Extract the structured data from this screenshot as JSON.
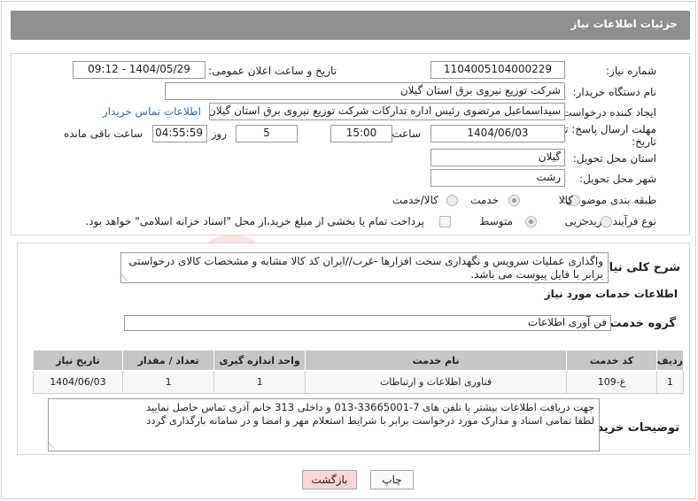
{
  "header": {
    "title": "جزئیات اطلاعات نیاز"
  },
  "form": {
    "need_number_label": "شماره نیاز:",
    "need_number": "1104005104000229",
    "announce_label": "تاریخ و ساعت اعلان عمومی:",
    "announce_value": "1404/05/29 - 09:12",
    "buyer_org_label": "نام دستگاه خریدار:",
    "buyer_org": "شرکت توزیع نیروی برق استان گیلان",
    "creator_label": "ایجاد کننده درخواست:",
    "creator": "سیداسماعیل مرتضوی رئیس اداره تدارکات شرکت توزیع نیروی برق استان گیلان",
    "contact_link": "اطلاعات تماس خریدار",
    "deadline_label_1": "مهلت ارسال پاسخ: تا",
    "deadline_label_2": "تاریخ:",
    "deadline_date": "1404/06/03",
    "time_label": "ساعت",
    "deadline_time": "15:00",
    "days_value": "5",
    "days_label": "روز و",
    "remaining_time": "04:55:59",
    "remaining_label": "ساعت باقی مانده",
    "province_label": "استان محل تحویل:",
    "province": "گیلان",
    "city_label": "شهر محل تحویل:",
    "city": "رشت",
    "category_label": "طبقه بندی موضوعی:",
    "category_options": [
      "کالا",
      "خدمت",
      "کالا/خدمت"
    ],
    "category_selected": "خدمت",
    "process_label": "نوع فرآیند خرید :",
    "process_options": [
      "جزیی",
      "متوسط"
    ],
    "process_selected": "متوسط",
    "payment_note": "پرداخت تمام یا بخشی از مبلغ خرید،از محل \"اسناد خزانه اسلامی\" خواهد بود."
  },
  "details": {
    "summary_label": "شرح کلی نیاز:",
    "summary": "واگذاری عملیات سرویس و نگهداری سخت افزارها -غرب//ایران کد کالا مشابه و مشخصات کالای درخواستی برابر با فایل پیوست می باشد.",
    "services_heading": "اطلاعات خدمات مورد نیاز",
    "service_group_label": "گروه خدمت:",
    "service_group": "فن آوری اطلاعات",
    "table": {
      "headers": [
        "ردیف",
        "کد خدمت",
        "نام خدمت",
        "واحد اندازه گیری",
        "تعداد / مقدار",
        "تاریخ نیاز"
      ],
      "rows": [
        [
          "1",
          "غ-109",
          "فناوری اطلاعات و ارتباطات",
          "1",
          "1",
          "1404/06/03"
        ]
      ]
    },
    "buyer_notes_label": "توضیحات خریدار:",
    "buyer_notes_line1": "جهت دریافت اطلاعات بیشتر با تلفن های 7-33665001-013 و داخلی 313 خانم آذری تماس حاصل نمایید",
    "buyer_notes_line2": "لطفا تمامی اسناد و مدارک مورد درخواست برابر با شرایط استعلام مهر و امضا و در سامانه بارگذاری گردد"
  },
  "buttons": {
    "print": "چاپ",
    "back": "بازگشت"
  },
  "colors": {
    "header_bg": "#8f8f8f",
    "table_header_bg": "#c6c6c6",
    "back_button_bg": "#f7d6d6",
    "link": "#2d6ab8"
  }
}
